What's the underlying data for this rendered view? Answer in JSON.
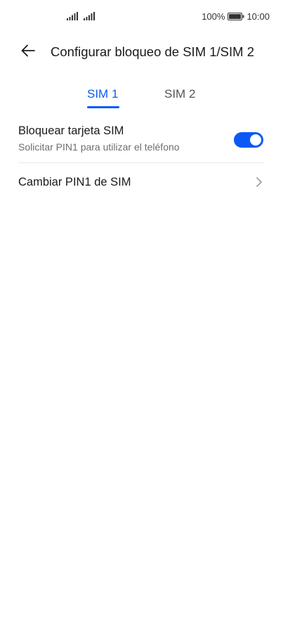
{
  "status_bar": {
    "battery_percent": "100%",
    "time": "10:00",
    "battery_level": 1.0
  },
  "header": {
    "title": "Configurar bloqueo de SIM 1/SIM 2"
  },
  "tabs": [
    {
      "label": "SIM 1",
      "selected": true
    },
    {
      "label": "SIM 2",
      "selected": false
    }
  ],
  "settings": {
    "lock_sim": {
      "title": "Bloquear tarjeta SIM",
      "subtitle": "Solicitar PIN1 para utilizar el teléfono",
      "enabled": true
    },
    "change_pin": {
      "title": "Cambiar PIN1 de SIM"
    }
  },
  "colors": {
    "accent": "#0a59f7",
    "text_primary": "#1a1a1a",
    "text_secondary": "#6e6e6e",
    "divider": "#e8e8e8"
  },
  "icons": [
    "signal-icon",
    "battery-icon",
    "back-arrow-icon",
    "chevron-right-icon"
  ]
}
